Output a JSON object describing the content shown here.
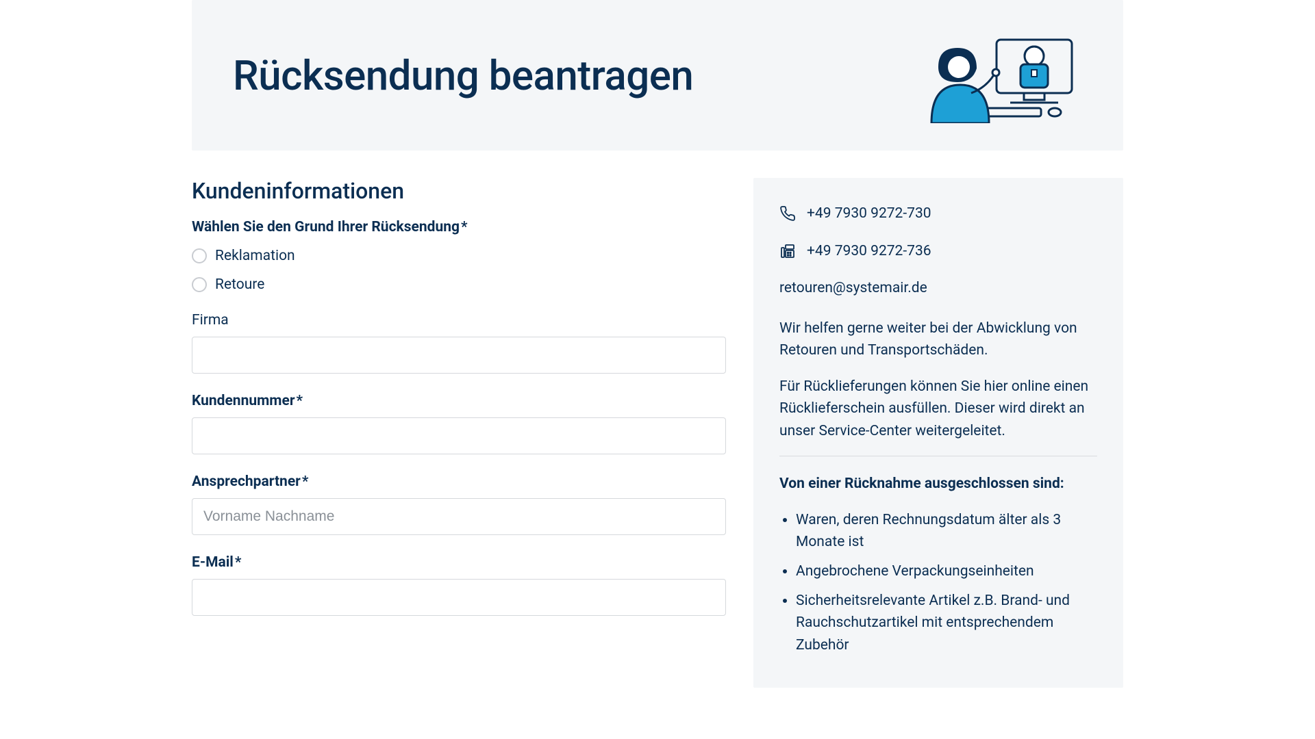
{
  "hero": {
    "title": "Rücksendung beantragen"
  },
  "form": {
    "section_heading": "Kundeninformationen",
    "reason": {
      "label": "Wählen Sie den Grund Ihrer Rücksendung",
      "required_mark": "*",
      "options": {
        "reklamation": "Reklamation",
        "retoure": "Retoure"
      }
    },
    "firma": {
      "label": "Firma",
      "value": ""
    },
    "kundennummer": {
      "label": "Kundennummer",
      "required_mark": "*",
      "value": ""
    },
    "ansprechpartner": {
      "label": "Ansprechpartner",
      "required_mark": "*",
      "placeholder": "Vorname Nachname",
      "value": ""
    },
    "email": {
      "label": "E-Mail",
      "required_mark": "*",
      "value": ""
    }
  },
  "sidebar": {
    "phone": "+49 7930 9272-730",
    "fax": "+49 7930 9272-736",
    "email": "retouren@systemair.de",
    "para1": "Wir helfen gerne weiter bei der Abwicklung von Retouren und Transportschäden.",
    "para2": "Für Rücklieferungen können Sie hier online einen Rücklieferschein ausfüllen. Dieser wird direkt an unser Service-Center weitergeleitet.",
    "exclusions_heading": "Von einer Rücknahme ausgeschlossen sind:",
    "exclusions": [
      "Waren, deren Rechnungsdatum älter als 3 Monate ist",
      "Angebrochene Verpackungseinheiten",
      "Sicherheitsrelevante Artikel z.B. Brand- und Rauchschutzartikel mit entsprechendem Zubehör"
    ]
  }
}
